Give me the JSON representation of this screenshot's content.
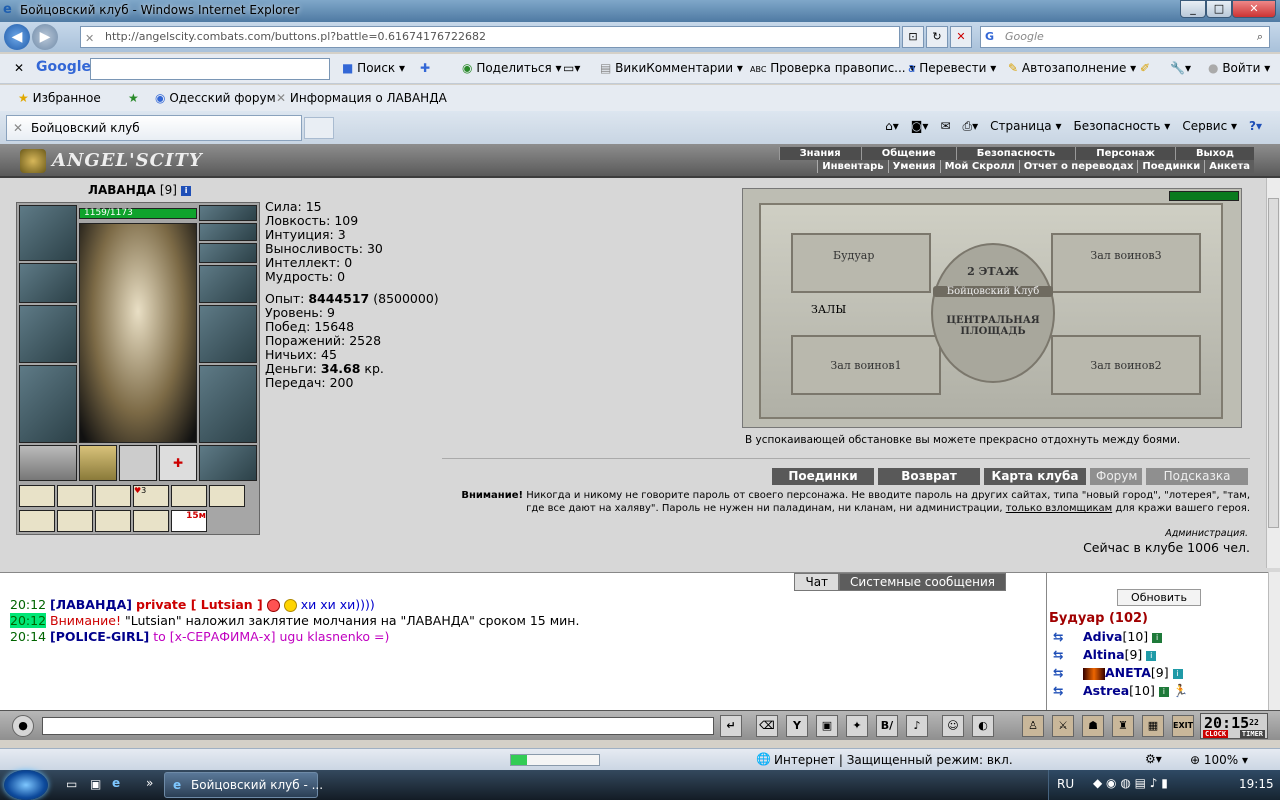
{
  "window": {
    "title": "Бойцовский клуб - Windows Internet Explorer"
  },
  "browser": {
    "url": "http://angelscity.combats.com/buttons.pl?battle=0.616741767226​82",
    "search_placeholder": "Google",
    "google_bar": {
      "logo": "Google",
      "items": [
        "Поиск",
        "Поделиться",
        "ВикиКомментарии",
        "Проверка правопис...",
        "Перевести",
        "Автозаполнение",
        "Войти"
      ]
    },
    "favorites": [
      "Избранное",
      "Одесский форум",
      "Информация о ЛАВАНДА"
    ],
    "tab_title": "Бойцовский клуб",
    "tools": [
      "Страница",
      "Безопасность",
      "Сервис"
    ]
  },
  "game": {
    "logo": "ANGEL'SCITY",
    "nav_primary": [
      "Знания",
      "Общение",
      "Безопасность",
      "Персонаж",
      "Выход"
    ],
    "nav_secondary": [
      "Инвентарь",
      "Умения",
      "Мой Скролл",
      "Отчет о переводах",
      "Поединки",
      "Анкета"
    ],
    "character": {
      "name": "ЛАВАНДА",
      "level": "[9]",
      "hp": "1159/1173",
      "hp_fraction": 0.988,
      "item_counter": "15м",
      "item_count_small": "3"
    },
    "stats": [
      {
        "label": "Сила:",
        "value": "15"
      },
      {
        "label": "Ловкость:",
        "value": "109"
      },
      {
        "label": "Интуиция:",
        "value": "3"
      },
      {
        "label": "Выносливость:",
        "value": "30"
      },
      {
        "label": "Интеллект:",
        "value": "0"
      },
      {
        "label": "Мудрость:",
        "value": "0"
      }
    ],
    "progress": {
      "exp_label": "Опыт:",
      "exp_value": "8444517",
      "exp_next": "(8500000)",
      "level_label": "Уровень:",
      "level_value": "9",
      "wins_label": "Побед:",
      "wins_value": "15648",
      "losses_label": "Поражений:",
      "losses_value": "2528",
      "draws_label": "Ничьих:",
      "draws_value": "45",
      "money_label": "Деньги:",
      "money_value": "34.68",
      "money_unit": "кр.",
      "transfers_label": "Передач:",
      "transfers_value": "200"
    },
    "map": {
      "rooms": [
        "Будуар",
        "Зал воинов3",
        "ЗАЛЫ",
        "Зал воинов1",
        "Зал воинов2"
      ],
      "center_floor": "2 ЭТАЖ",
      "center_club": "Бойцовский Клуб",
      "center_square": "ЦЕНТРАЛЬНАЯ ПЛОЩАДЬ",
      "caption": "В успокаивающей обстановке вы можете прекрасно отдохнуть между боями."
    },
    "map_buttons": [
      "Поединки",
      "Возврат",
      "Карта клуба",
      "Форум",
      "Подсказка"
    ],
    "warning": {
      "bold": "Внимание!",
      "text": " Никогда и никому не говорите пароль от своего персонажа. Не вводите пароль на других сайтах, типа \"новый город\", \"лотерея\", \"там, где все дают на халяву\". Пароль не нужен ни паладинам, ни кланам, ни администрации, ",
      "link": "только взломщикам",
      "tail": " для кражи вашего героя.",
      "admin": "Администрация."
    },
    "online": "Сейчас в клубе 1006 чел."
  },
  "chat": {
    "tabs": [
      "Чат",
      "Системные сообщения"
    ],
    "lines": [
      {
        "time": "20:12",
        "who": "[ЛАВАНДА]",
        "priv": "private [ Lutsian ]",
        "msg": "хи хи хи))))"
      },
      {
        "time": "20:12",
        "warn": "Внимание!",
        "msg": "\"Lutsian\" наложил заклятие молчания на \"ЛАВАНДА\" сроком 15 мин."
      },
      {
        "time": "20:14",
        "who": "[POLICE-GIRL]",
        "msg": "to [x-СЕРАФИМА-x] ugu klasnenko =)"
      }
    ]
  },
  "userlist": {
    "refresh": "Обновить",
    "room": "Будуар (102)",
    "users": [
      {
        "name": "Adiva",
        "level": "[10]"
      },
      {
        "name": "Altina",
        "level": "[9]"
      },
      {
        "name": "ANETA",
        "level": "[9]"
      },
      {
        "name": "Astrea",
        "level": "[10]"
      }
    ]
  },
  "clock": {
    "time": "20:15",
    "sec": "22",
    "clock_label": "CLOCK",
    "timer_label": "TIMER"
  },
  "statusbar": {
    "zone": "Интернет | Защищенный режим: вкл.",
    "zoom": "100%",
    "progress": 0.18
  },
  "taskbar": {
    "task": "Бойцовский клуб - ...",
    "lang": "RU",
    "time": "19:15"
  }
}
